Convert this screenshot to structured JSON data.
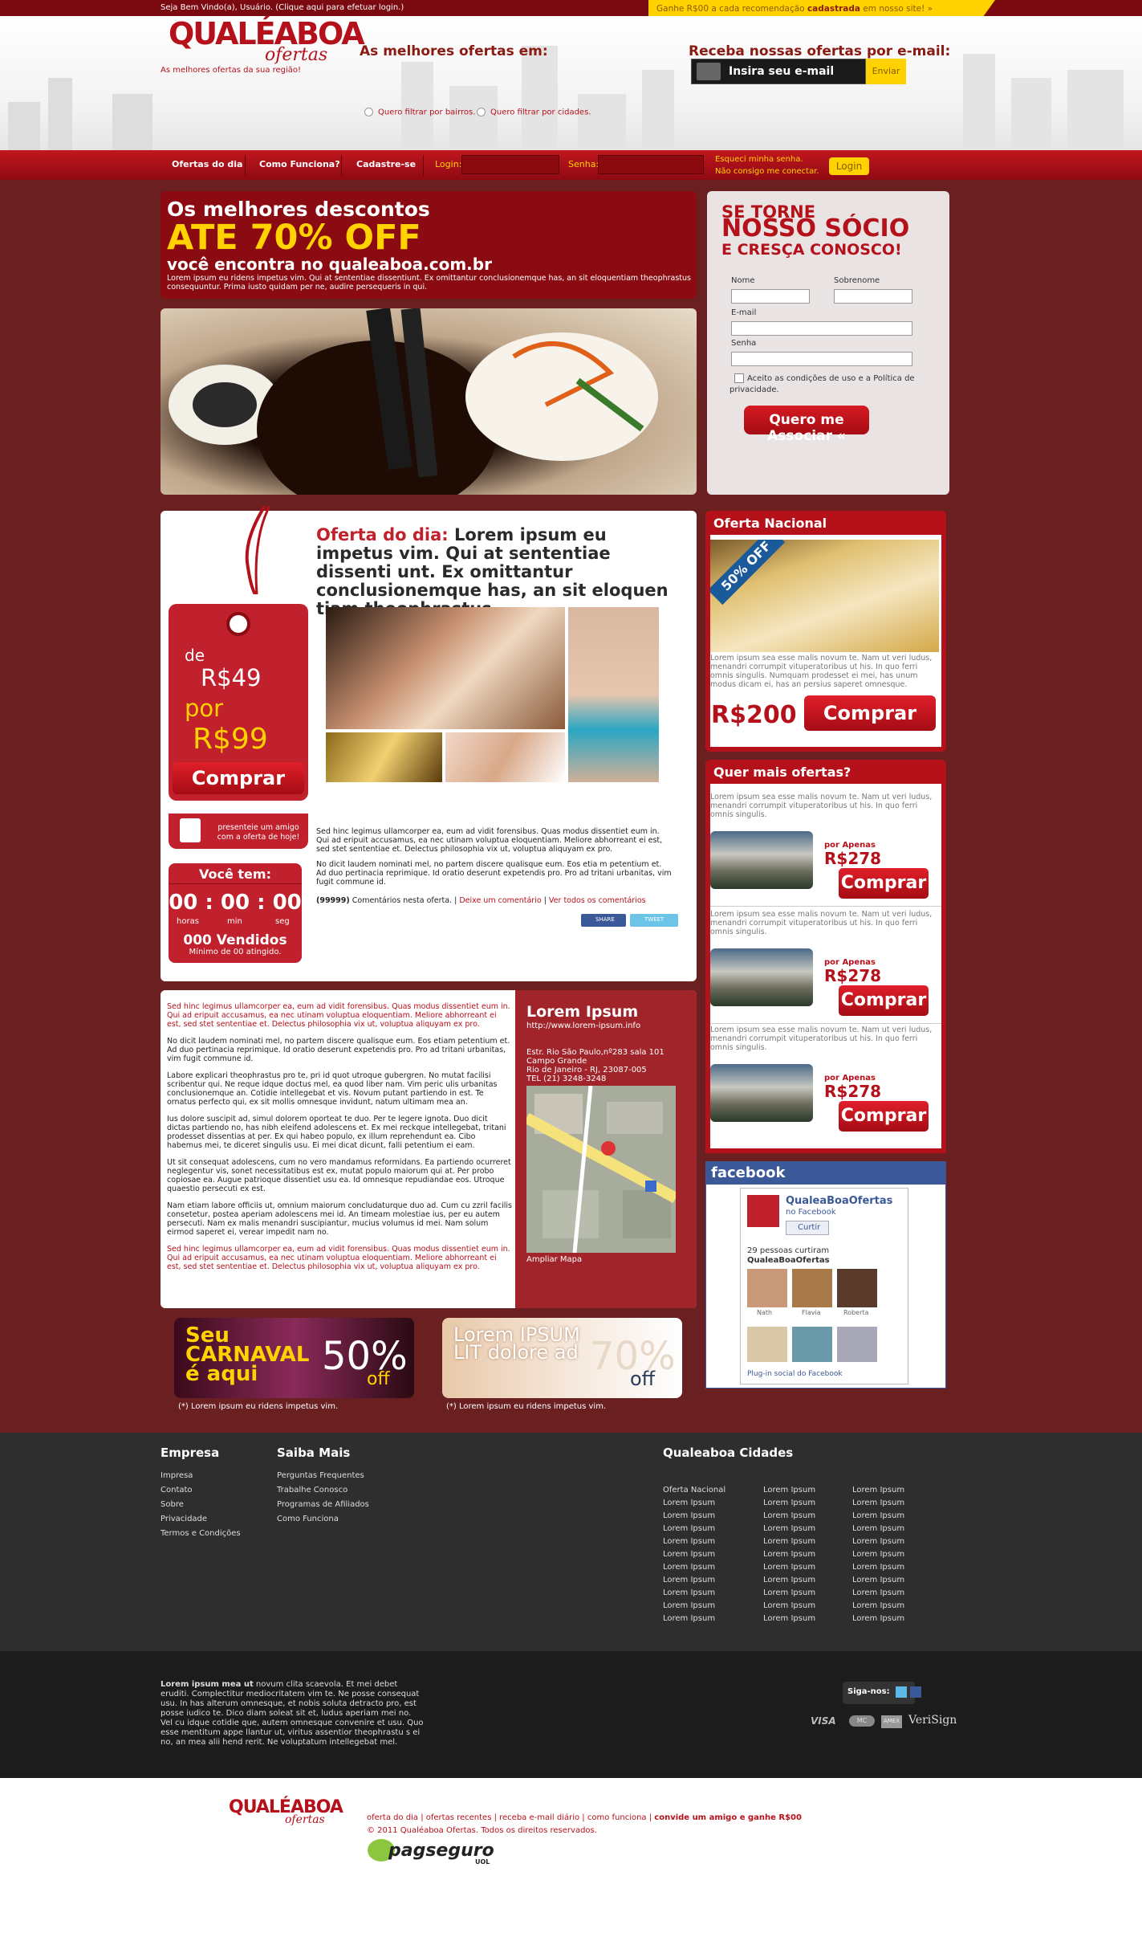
{
  "topbar": {
    "welcome": "Seja Bem Vindo(a), Usuário. (Clique aqui para efetuar login.)",
    "promo_prefix": "Ganhe R$00 a cada recomendação ",
    "promo_bold": "cadastrada",
    "promo_suffix": " em nosso site! »"
  },
  "header": {
    "logo_main": "QUALÉABOA",
    "logo_sub": "ofertas",
    "tagline": "As melhores ofertas da sua região!",
    "best_title": "As melhores ofertas em:",
    "filter_bairros": "Quero filtrar por bairros.",
    "filter_cidades": "Quero filtrar por cidades.",
    "newsletter_title": "Receba nossas ofertas por e-mail:",
    "email_placeholder": "Insira seu e-mail",
    "send_label": "Enviar"
  },
  "nav": {
    "items": [
      "Ofertas do dia",
      "Como Funciona?",
      "Cadastre-se"
    ],
    "login_label": "Login:",
    "password_label": "Senha:",
    "forgot1": "Esqueci minha senha.",
    "forgot2": "Não consigo me conectar.",
    "login_button": "Login"
  },
  "hero": {
    "line1": "Os melhores descontos",
    "line2": "ATE 70% OFF",
    "line3": "você encontra no qualeaboa.com.br",
    "para": "Lorem ipsum eu ridens impetus vim. Qui at sententiae dissentiunt. Ex omittantur conclusionemque has, an sit eloquentiam theophrastus consequuntur. Prima iusto quidam per ne, audire persequeris in qui."
  },
  "signup": {
    "t1": "SE TORNE",
    "t2": "NOSSO SÓCIO",
    "t3": "E CRESÇA CONOSCO!",
    "nome": "Nome",
    "sobrenome": "Sobrenome",
    "email": "E-mail",
    "senha": "Senha",
    "terms": "Aceito as condições de uso e a Política de privacidade.",
    "button": "Quero me Associar «"
  },
  "deal": {
    "de": "de",
    "old_price": "R$49",
    "por": "por",
    "new_price": "R$99",
    "buy": "Comprar",
    "gift": "presenteie um amigo com a oferta de hoje!",
    "timer_title": "Você tem:",
    "clock": "00 : 00 : 00",
    "units": [
      "horas",
      "min",
      "seg"
    ],
    "sold": "000 Vendidos",
    "minimum": "Mínimo de 00 atingido.",
    "title_label": "Oferta do dia:",
    "title": " Lorem ipsum eu impetus vim. Qui at sententiae dissenti unt. Ex omittantur conclusionemque has, an sit eloquen tiam theophrastus.",
    "text1": "Sed hinc legimus ullamcorper ea, eum ad vidit forensibus. Quas modus dissentiet eum in. Qui ad eripuit accusamus, ea nec utinam voluptua eloquentiam. Meliore abhorreant ei est, sed stet sententiae et. Delectus philosophia vix ut, voluptua aliquyam ex pro.",
    "text2": "No dicit laudem nominati mel, no partem discere qualisque eum. Eos etia m petentium et. Ad duo pertinacia reprimique. Id oratio deserunt expetendis pro. Pro ad tritani urbanitas, vim fugit commune id.",
    "comments_count": "(99999)",
    "comments_text": " Comentários nesta oferta.",
    "comment_link": "Deixe um comentário",
    "all_comments": "Ver todos os comentários",
    "share": "SHARE",
    "tweet": "TWEET"
  },
  "national": {
    "title": "Oferta Nacional",
    "badge": "50% OFF",
    "text": "Lorem ipsum sea esse malis novum te. Nam ut veri ludus, menandri corrumpit vituperatoribus ut his. In quo ferri omnis singulis. Numquam prodesset ei mei, has unum modus dicam ei, has an persius saperet omnesque.",
    "price": "R$200",
    "buy": "Comprar"
  },
  "more": {
    "title": "Quer mais ofertas?",
    "items": [
      {
        "text": "Lorem ipsum sea esse malis novum te. Nam ut veri ludus, menandri corrumpit vituperatoribus ut his. In quo ferri omnis singulis.",
        "por": "por Apenas",
        "price": "R$278",
        "buy": "Comprar"
      },
      {
        "text": "Lorem ipsum sea esse malis novum te. Nam ut veri ludus, menandri corrumpit vituperatoribus ut his. In quo ferri omnis singulis.",
        "por": "por Apenas",
        "price": "R$278",
        "buy": "Comprar"
      },
      {
        "text": "Lorem ipsum sea esse malis novum te. Nam ut veri ludus, menandri corrumpit vituperatoribus ut his. In quo ferri omnis singulis.",
        "por": "por Apenas",
        "price": "R$278",
        "buy": "Comprar"
      }
    ]
  },
  "facebook": {
    "header": "facebook",
    "page_name": "QualeaBoaOfertas",
    "on_fb": "no Facebook",
    "like": "Curtir",
    "count": "29 pessoas curtiram",
    "page_bold": "QualeaBoaOfertas",
    "friends": [
      "Nath",
      "Flavia",
      "Roberta"
    ],
    "plugin": "Plug-in social do Facebook"
  },
  "article": {
    "p_red1": "Sed hinc legimus ullamcorper ea, eum ad vidit forensibus. Quas modus dissentiet eum in. Qui ad eripuit accusamus, ea nec utinam voluptua eloquentiam. Meliore abhorreant ei est, sed stet sententiae et. Delectus philosophia vix ut, voluptua aliquyam ex pro.",
    "p1": "No dicit laudem nominati mel, no partem discere qualisque eum. Eos etiam petentium et. Ad duo pertinacia reprimique. Id oratio deserunt expetendis pro. Pro ad tritani urbanitas, vim fugit commune id.",
    "p2": "Labore explicari theophrastus pro te, pri id quot utroque gubergren. No mutat facilisi scribentur qui. Ne reque idque doctus mel, ea quod liber nam. Vim peric ulis urbanitas conclusionemque an. Cotidie intellegebat et vis. Novum putant partiendo in est. Te ornatus perfecto qui, ex sit mollis omnesque invidunt, natum ultimam mea an.",
    "p3": "Ius dolore suscipit ad, simul dolorem oporteat te duo. Per te legere ignota. Duo dicit dictas partiendo no, has nibh eleifend adolescens et. Ex mei reckque intellegebat, tritani prodesset dissentias at per. Ex qui habeo populo, ex illum reprehendunt ea. Cibo habemus mei, te diceret singulis usu. Ei mei dicat dicunt, falli petentium ei eam.",
    "p4": "Ut sit consequat adolescens, cum no vero mandamus reformidans. Ea partiendo ocurreret neglegentur vis, sonet necessitatibus est ex, mutat populo maiorum qui at. Per probo copiosae ea. Augue patrioque dissentiet usu ea. Id omnesque repudiandae eos. Utroque quaestio persecuti ex est.",
    "p5": "Nam etiam labore officiis ut, omnium maiorum concludaturque duo ad. Cum cu zzril facilis consetetur, postea aperiam adolescens mei id. An timeam molestiae ius, per eu autem persecuti. Nam ex malis menandri suscipiantur, mucius volumus id mei. Nam solum eirmod saperet ei, verear impedit nam no.",
    "p_red2": "Sed hinc legimus ullamcorper ea, eum ad vidit forensibus. Quas modus dissentiet eum in. Qui ad eripuit accusamus, ea nec utinam voluptua eloquentiam. Meliore abhorreant ei est, sed stet sententiae et. Delectus philosophia vix ut, voluptua aliquyam ex pro.",
    "side_title": "Lorem Ipsum",
    "side_url": "http://www.lorem-ipsum.info",
    "address1": "Estr. Rio São Paulo,nº283 sala 101",
    "address2": "Campo Grande",
    "address3": "Rio de Janeiro - RJ, 23087-005",
    "phone": "TEL (21) 3248-3248",
    "map_link": "Ampliar Mapa"
  },
  "banners": [
    {
      "big": "Seu CARNAVAL é aqui",
      "pct": "50%",
      "off": "off",
      "caption": "(*) Lorem ipsum eu ridens impetus vim."
    },
    {
      "big": "Lorem IPSUM LIT dolore ad",
      "pct": "70%",
      "off": "off",
      "caption": "(*) Lorem ipsum eu ridens impetus vim."
    }
  ],
  "footer": {
    "empresa_title": "Empresa",
    "empresa_links": [
      "Impresa",
      "Contato",
      "Sobre",
      "Privacidade",
      "Termos e Condições"
    ],
    "saiba_title": "Saiba Mais",
    "saiba_links": [
      "Perguntas Frequentes",
      "Trabalhe Conosco",
      "Programas de Afiliados",
      "Como Funciona"
    ],
    "cidades_title": "Qualeaboa Cidades",
    "cidades_col1": [
      "Oferta Nacional",
      "Lorem Ipsum",
      "Lorem Ipsum",
      "Lorem Ipsum",
      "Lorem Ipsum",
      "Lorem Ipsum",
      "Lorem Ipsum",
      "Lorem Ipsum",
      "Lorem Ipsum",
      "Lorem Ipsum",
      "Lorem Ipsum"
    ],
    "cidades_col2": [
      "Lorem Ipsum",
      "Lorem Ipsum",
      "Lorem Ipsum",
      "Lorem Ipsum",
      "Lorem Ipsum",
      "Lorem Ipsum",
      "Lorem Ipsum",
      "Lorem Ipsum",
      "Lorem Ipsum",
      "Lorem Ipsum",
      "Lorem Ipsum"
    ],
    "cidades_col3": [
      "Lorem Ipsum",
      "Lorem Ipsum",
      "Lorem Ipsum",
      "Lorem Ipsum",
      "Lorem Ipsum",
      "Lorem Ipsum",
      "Lorem Ipsum",
      "Lorem Ipsum",
      "Lorem Ipsum",
      "Lorem Ipsum",
      "Lorem Ipsum"
    ],
    "about_bold": "Lorem ipsum mea ut",
    "about": " novum clita scaevola. Et mei debet eruditi. Complectitur mediocritatem vim te. Ne posse consequat usu. In has alterum omnesque, et nobis soluta detracto pro, est posse iudico te. Dico diam soleat sit et, ludus aperiam mei no. Vel cu idque cotidie que, autem omnesque convenire et usu. Quo esse mentitum appe llantur ut, viritus assentior theophrastu s ei no, an mea alii hend rerit. Ne voluptatum intellegebat mel.",
    "follow": "Siga-nos:",
    "payments": [
      "VISA",
      "MC",
      "AMEX",
      "VeriSign"
    ],
    "bottom_links": "oferta do dia | ofertas recentes | receba e-mail diário | como funciona | ",
    "bottom_bold": "convide um amigo e ganhe R$00",
    "copyright": "© 2011 Qualéaboa Ofertas. Todos os direitos reservados.",
    "pagseguro": "pagseguro",
    "uol": "UOL"
  },
  "colors": {
    "brand_red": "#b5111b",
    "dark_red": "#6a2020",
    "yellow": "#ffd200"
  }
}
